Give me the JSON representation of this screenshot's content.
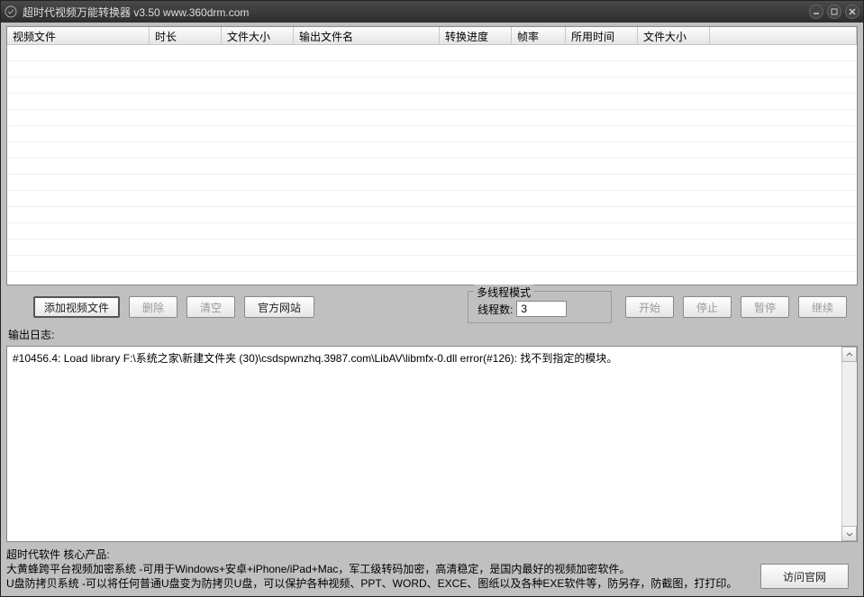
{
  "window": {
    "title": "超时代视频万能转换器 v3.50    www.360drm.com"
  },
  "table": {
    "columns": [
      "视频文件",
      "时长",
      "文件大小",
      "输出文件名",
      "转换进度",
      "帧率",
      "所用时间",
      "文件大小",
      ""
    ]
  },
  "actions": {
    "add": "添加视频文件",
    "delete": "删除",
    "clear": "清空",
    "official": "官方网站"
  },
  "thread": {
    "legend": "多线程模式",
    "label": "线程数:",
    "value": "3"
  },
  "controls": {
    "start": "开始",
    "stop": "停止",
    "pause": "暂停",
    "resume": "继续"
  },
  "log": {
    "label": "输出日志:",
    "content": "#10456.4: Load library F:\\系统之家\\新建文件夹 (30)\\csdspwnzhq.3987.com\\LibAV\\libmfx-0.dll error(#126): 找不到指定的模块。"
  },
  "footer": {
    "line1": "超时代软件 核心产品:",
    "line2": "大黄蜂跨平台视频加密系统 -可用于Windows+安卓+iPhone/iPad+Mac，军工级转码加密，高清稳定，是国内最好的视频加密软件。",
    "line3": "U盘防拷贝系统 -可以将任何普通U盘变为防拷贝U盘，可以保护各种视频、PPT、WORD、EXCE、图纸以及各种EXE软件等，防另存，防截图，打打印。",
    "visit": "访问官网"
  }
}
